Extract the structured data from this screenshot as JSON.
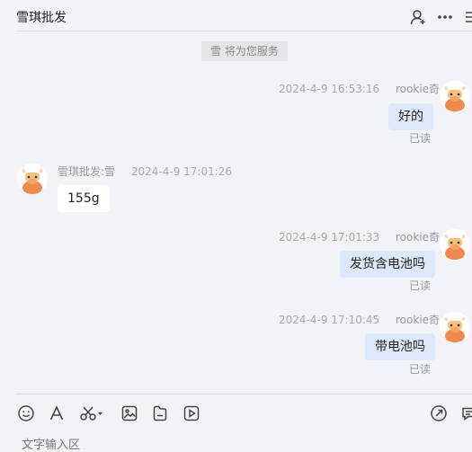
{
  "header": {
    "title": "雪琪批发",
    "icons": [
      "add-user-icon",
      "more-icon",
      "list-icon"
    ]
  },
  "system_message": "雪 将为您服务",
  "messages": [
    {
      "side": "right",
      "sender": "rookie奇",
      "time": "2024-4-9 16:53:16",
      "text": "好的",
      "status": "已读"
    },
    {
      "side": "left",
      "sender": "雪琪批发:雪",
      "time": "2024-4-9 17:01:26",
      "text": "155g"
    },
    {
      "side": "right",
      "sender": "rookie奇",
      "time": "2024-4-9 17:01:33",
      "text": "发货含电池吗",
      "status": "已读"
    },
    {
      "side": "right",
      "sender": "rookie奇",
      "time": "2024-4-9 17:10:45",
      "text": "带电池吗",
      "status": "已读"
    }
  ],
  "toolbar": {
    "left_icons": [
      "emoji-icon",
      "font-icon",
      "scissors-icon",
      "image-icon",
      "file-icon",
      "video-icon"
    ],
    "right_icons": [
      "send-icon",
      "message-icon"
    ]
  },
  "input": {
    "placeholder": "文字输入区"
  },
  "colors": {
    "background": "#f2f3f7",
    "my_bubble": "#dde8fb",
    "their_bubble": "#ffffff",
    "avatar_orange": "#f0894a"
  }
}
